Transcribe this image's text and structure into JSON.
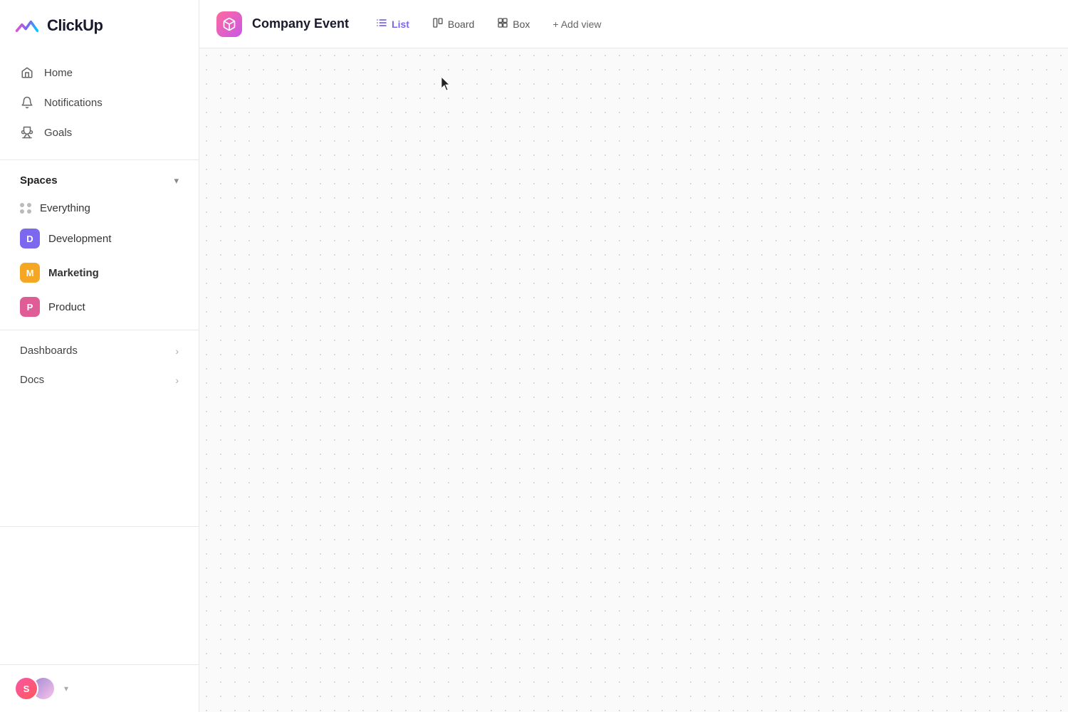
{
  "logo": {
    "text": "ClickUp"
  },
  "sidebar": {
    "nav": [
      {
        "id": "home",
        "label": "Home",
        "icon": "home"
      },
      {
        "id": "notifications",
        "label": "Notifications",
        "icon": "bell"
      },
      {
        "id": "goals",
        "label": "Goals",
        "icon": "trophy"
      }
    ],
    "spaces": {
      "title": "Spaces",
      "items": [
        {
          "id": "everything",
          "label": "Everything",
          "type": "dots"
        },
        {
          "id": "development",
          "label": "Development",
          "type": "badge",
          "badge_color": "blue",
          "badge_char": "D"
        },
        {
          "id": "marketing",
          "label": "Marketing",
          "type": "badge",
          "badge_color": "yellow",
          "badge_char": "M",
          "active": true
        },
        {
          "id": "product",
          "label": "Product",
          "type": "badge",
          "badge_color": "pink",
          "badge_char": "P"
        }
      ]
    },
    "sections": [
      {
        "id": "dashboards",
        "label": "Dashboards"
      },
      {
        "id": "docs",
        "label": "Docs"
      }
    ],
    "footer": {
      "avatar1_label": "S",
      "chevron": "▾"
    }
  },
  "topbar": {
    "project_icon": "📦",
    "project_title": "Company Event",
    "tabs": [
      {
        "id": "list",
        "label": "List",
        "icon": "list",
        "active": true
      },
      {
        "id": "board",
        "label": "Board",
        "icon": "board"
      },
      {
        "id": "box",
        "label": "Box",
        "icon": "box"
      }
    ],
    "add_view_label": "+ Add view"
  }
}
